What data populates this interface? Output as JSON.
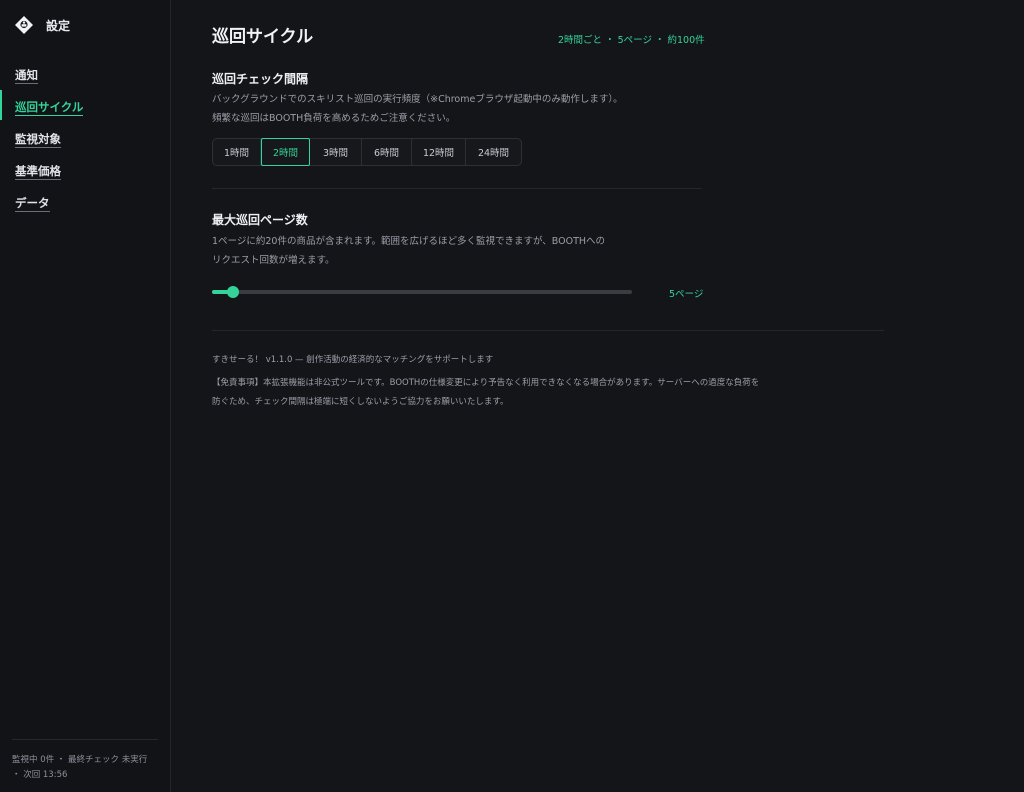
{
  "app": {
    "title": "設定"
  },
  "sidebar": {
    "items": [
      {
        "label": "通知",
        "active": false
      },
      {
        "label": "巡回サイクル",
        "active": true
      },
      {
        "label": "監視対象",
        "active": false
      },
      {
        "label": "基準価格",
        "active": false
      },
      {
        "label": "データ",
        "active": false
      }
    ],
    "status_line1": "監視中 0件 ・ 最終チェック 未実行",
    "status_line2": "・ 次回 13:56"
  },
  "main": {
    "title": "巡回サイクル",
    "summary": "2時間ごと ・ 5ページ ・ 約100件",
    "interval": {
      "title": "巡回チェック間隔",
      "desc_line1": "バックグラウンドでのスキリスト巡回の実行頻度（※Chromeブラウザ起動中のみ動作します）。",
      "desc_line2": "頻繁な巡回はBOOTH負荷を高めるためご注意ください。",
      "options": [
        "1時間",
        "2時間",
        "3時間",
        "6時間",
        "12時間",
        "24時間"
      ],
      "selected_index": 1
    },
    "pages": {
      "title": "最大巡回ページ数",
      "desc_line1": "1ページに約20件の商品が含まれます。範囲を広げるほど多く監視できますが、BOOTHへの",
      "desc_line2": "リクエスト回数が増えます。",
      "value_label": "5ページ",
      "slider_fraction": 0.05
    },
    "footer": {
      "version_line": "すきせーる！ v1.1.0 — 創作活動の経済的なマッチングをサポートします",
      "disclaimer_line1": "【免責事項】本拡張機能は非公式ツールです。BOOTHの仕様変更により予告なく利用できなくなる場合があります。サーバーへの過度な負荷を",
      "disclaimer_line2": "防ぐため、チェック間隔は極端に短くしないようご協力をお願いいたします。"
    }
  },
  "colors": {
    "accent": "#34d399",
    "background": "#141519"
  }
}
